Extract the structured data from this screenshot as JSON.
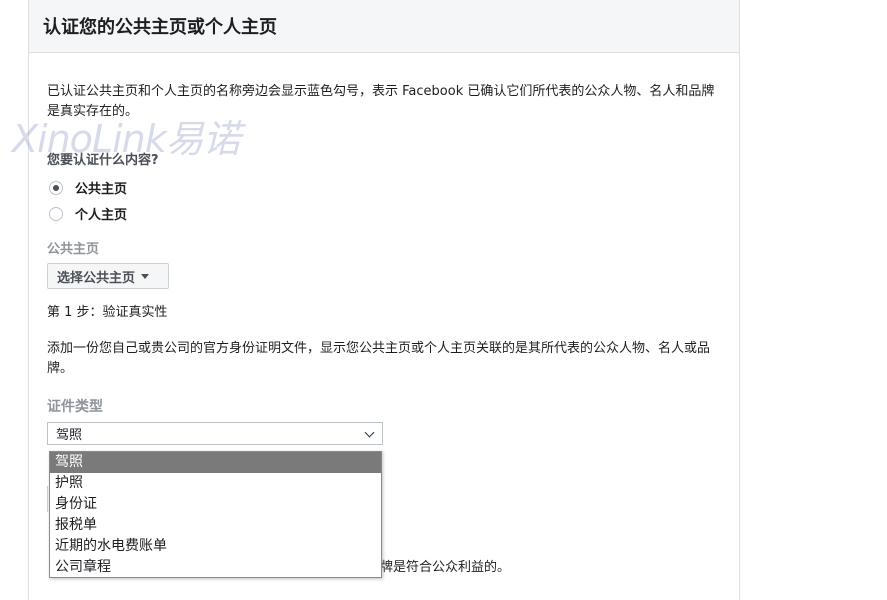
{
  "panel": {
    "title": "认证您的公共主页或个人主页"
  },
  "intro": "已认证公共主页和个人主页的名称旁边会显示蓝色勾号，表示 Facebook 已确认它们所代表的公众人物、名人和品牌是真实存在的。",
  "watermark": "XinoLink易诺",
  "question": "您要认证什么内容?",
  "options": [
    {
      "label": "公共主页",
      "checked": true
    },
    {
      "label": "个人主页",
      "checked": false
    }
  ],
  "page_section": {
    "label": "公共主页",
    "button_label": "选择公共主页"
  },
  "step1": {
    "title": "第 1 步：验证真实性",
    "desc": "添加一份您自己或贵公司的官方身份证明文件，显示您公共主页或个人主页关联的是其所代表的公众人物、名人或品牌。"
  },
  "doc_type": {
    "label": "证件类型",
    "selected": "驾照",
    "options": [
      "驾照",
      "护照",
      "身份证",
      "报税单",
      "近期的水电费账单",
      "公司章程"
    ]
  },
  "partial_text": "牌是符合公众利益的。",
  "colors": {
    "header_bg": "#f5f6f7",
    "border": "#dddfe2",
    "selected_option_bg": "#7a7a7a"
  }
}
